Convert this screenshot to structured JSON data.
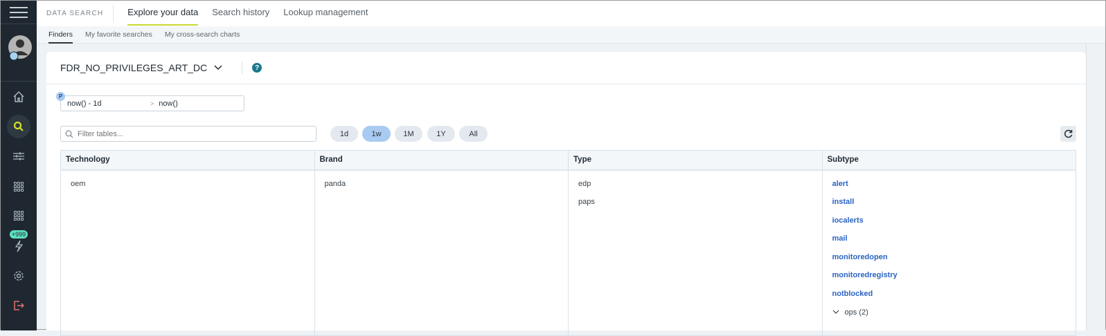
{
  "sidebar": {
    "badge": "+999",
    "items": [
      "home",
      "search",
      "filters",
      "apps",
      "apps-2",
      "alerts",
      "settings",
      "logout"
    ]
  },
  "topbar": {
    "brand": "DATA SEARCH",
    "tabs": [
      "Explore your data",
      "Search history",
      "Lookup management"
    ]
  },
  "subtabs": [
    "Finders",
    "My favorite searches",
    "My cross-search charts"
  ],
  "finder": {
    "name": "FDR_NO_PRIVILEGES_ART_DC",
    "help": "?"
  },
  "date": {
    "badge": "P",
    "from": "now() - 1d",
    "sep": ">",
    "to": "now()"
  },
  "filter": {
    "placeholder": "Filter tables..."
  },
  "ranges": [
    "1d",
    "1w",
    "1M",
    "1Y",
    "All"
  ],
  "selected_range": "1w",
  "table": {
    "headers": [
      "Technology",
      "Brand",
      "Type",
      "Subtype"
    ],
    "technology": [
      "oem"
    ],
    "brand": [
      "panda"
    ],
    "type": [
      "edp",
      "paps"
    ],
    "subtype": [
      "alert",
      "install",
      "iocalerts",
      "mail",
      "monitoredopen",
      "monitoredregistry",
      "notblocked"
    ],
    "group": "ops (2)"
  },
  "colors": {
    "accent": "#c7d92f",
    "link": "#2b63c4",
    "sidebar": "#1f2831"
  }
}
